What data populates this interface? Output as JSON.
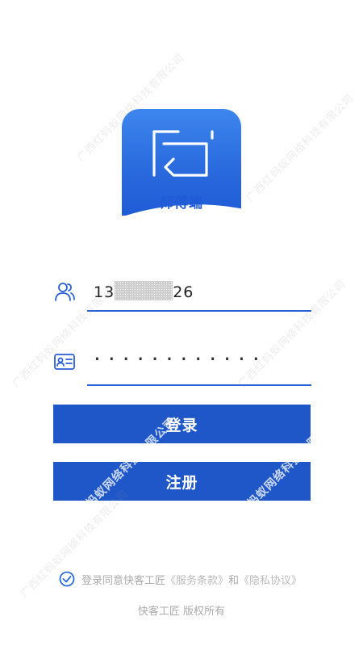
{
  "logo": {
    "label": "师傅端",
    "colors": {
      "primary": "#2a6bde",
      "light": "#3d86ee"
    }
  },
  "account": {
    "prefix": "13",
    "suffix": "26",
    "icon": "users-icon"
  },
  "password": {
    "masked": "············",
    "icon": "id-card-icon"
  },
  "buttons": {
    "login": "登录",
    "register": "注册"
  },
  "agreement": {
    "prefix": "登录同意快客工匠",
    "terms": "《服务条款》",
    "and": "和",
    "privacy": "《隐私协议》",
    "checked": true
  },
  "footer": {
    "copyright": "快客工匠 版权所有"
  },
  "watermark": {
    "text": "广西红蚂蚁网络科技有限公司"
  },
  "colors": {
    "accent": "#1f57c8",
    "underline": "#2a5ed6"
  }
}
